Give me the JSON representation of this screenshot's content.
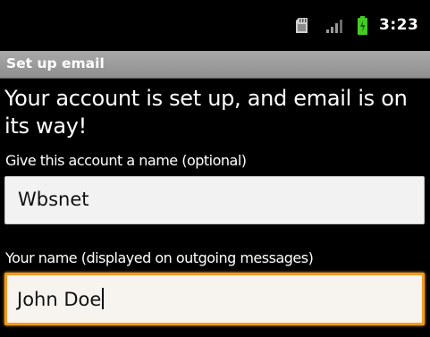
{
  "status_bar": {
    "time": "3:23",
    "icons": [
      "sd-card-icon",
      "signal-icon",
      "battery-icon"
    ],
    "battery_color": "#44cc22"
  },
  "title_bar": {
    "title": "Set up email"
  },
  "main": {
    "headline": "Your account is set up, and email is on its way!",
    "account_name_label": "Give this account a name (optional)",
    "account_name_value": "Wbsnet",
    "your_name_label": "Your name (displayed on outgoing messages)",
    "your_name_value": "John Doe"
  },
  "colors": {
    "focus_border": "#f39a1e",
    "field_background": "#f2f2f2",
    "title_bar": "#9e9e9e"
  }
}
